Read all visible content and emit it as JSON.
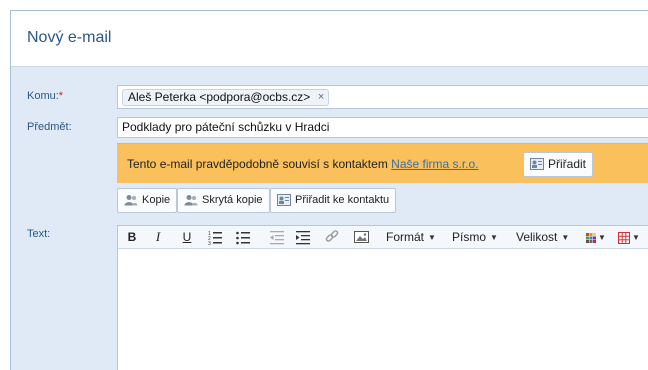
{
  "header": {
    "title": "Nový e-mail"
  },
  "form": {
    "to_label": "Komu:",
    "required_mark": "*",
    "recipient": "Aleš Peterka <podpora@ocbs.cz>",
    "recipient_remove": "×",
    "subject_label": "Předmět:",
    "subject_value": "Podklady pro páteční schůzku v Hradci",
    "text_label": "Text:"
  },
  "suggestion": {
    "message": "Tento e-mail pravděpodobně souvisí s kontaktem",
    "contact_link": "Naše firma s.r.o.",
    "assign_button": "Přiřadit"
  },
  "actions": {
    "cc_button": "Kopie",
    "bcc_button": "Skrytá kopie",
    "assign_contact_button": "Přiřadit ke kontaktu"
  },
  "toolbar": {
    "bold": "B",
    "italic": "I",
    "underline": "U",
    "format": "Formát",
    "font": "Písmo",
    "size": "Velikost"
  },
  "colors": {
    "suggestion_bg": "#f9c05b",
    "title": "#2a5785",
    "link": "#3a6ea5"
  }
}
